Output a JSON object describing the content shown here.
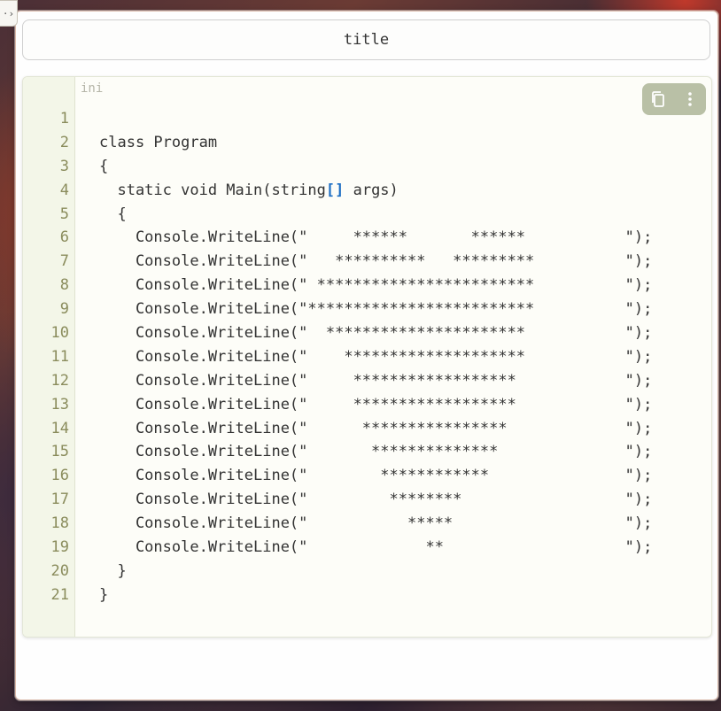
{
  "edge_tab": {
    "glyph": "·›"
  },
  "window": {
    "title": "title"
  },
  "code_block": {
    "language": "ini",
    "toolbar": {
      "copy_icon": "copy-icon",
      "more_icon": "more-vertical-icon"
    },
    "accent_color": "#1e6fc4",
    "gutter_color": "#f3f6e8",
    "line_number_color": "#8a8c5c",
    "lines": [
      {
        "n": "1",
        "pre": "",
        "bracket": "",
        "post": ""
      },
      {
        "n": "2",
        "pre": "class Program",
        "bracket": "",
        "post": ""
      },
      {
        "n": "3",
        "pre": "{",
        "bracket": "",
        "post": ""
      },
      {
        "n": "4",
        "pre": "  static void Main(string",
        "bracket": "[]",
        "post": " args)"
      },
      {
        "n": "5",
        "pre": "  {",
        "bracket": "",
        "post": ""
      },
      {
        "n": "6",
        "pre": "    Console.WriteLine(\"     ******       ******           \");",
        "bracket": "",
        "post": ""
      },
      {
        "n": "7",
        "pre": "    Console.WriteLine(\"   **********   *********          \");",
        "bracket": "",
        "post": ""
      },
      {
        "n": "8",
        "pre": "    Console.WriteLine(\" ************************          \");",
        "bracket": "",
        "post": ""
      },
      {
        "n": "9",
        "pre": "    Console.WriteLine(\"*************************          \");",
        "bracket": "",
        "post": ""
      },
      {
        "n": "10",
        "pre": "    Console.WriteLine(\"  **********************           \");",
        "bracket": "",
        "post": ""
      },
      {
        "n": "11",
        "pre": "    Console.WriteLine(\"    ********************           \");",
        "bracket": "",
        "post": ""
      },
      {
        "n": "12",
        "pre": "    Console.WriteLine(\"     ******************            \");",
        "bracket": "",
        "post": ""
      },
      {
        "n": "13",
        "pre": "    Console.WriteLine(\"     ******************            \");",
        "bracket": "",
        "post": ""
      },
      {
        "n": "14",
        "pre": "    Console.WriteLine(\"      ****************             \");",
        "bracket": "",
        "post": ""
      },
      {
        "n": "15",
        "pre": "    Console.WriteLine(\"       **************              \");",
        "bracket": "",
        "post": ""
      },
      {
        "n": "16",
        "pre": "    Console.WriteLine(\"        ************               \");",
        "bracket": "",
        "post": ""
      },
      {
        "n": "17",
        "pre": "    Console.WriteLine(\"         ********                  \");",
        "bracket": "",
        "post": ""
      },
      {
        "n": "18",
        "pre": "    Console.WriteLine(\"           *****                   \");",
        "bracket": "",
        "post": ""
      },
      {
        "n": "19",
        "pre": "    Console.WriteLine(\"             **                    \");",
        "bracket": "",
        "post": ""
      },
      {
        "n": "20",
        "pre": "  }",
        "bracket": "",
        "post": ""
      },
      {
        "n": "21",
        "pre": "}",
        "bracket": "",
        "post": ""
      }
    ]
  }
}
